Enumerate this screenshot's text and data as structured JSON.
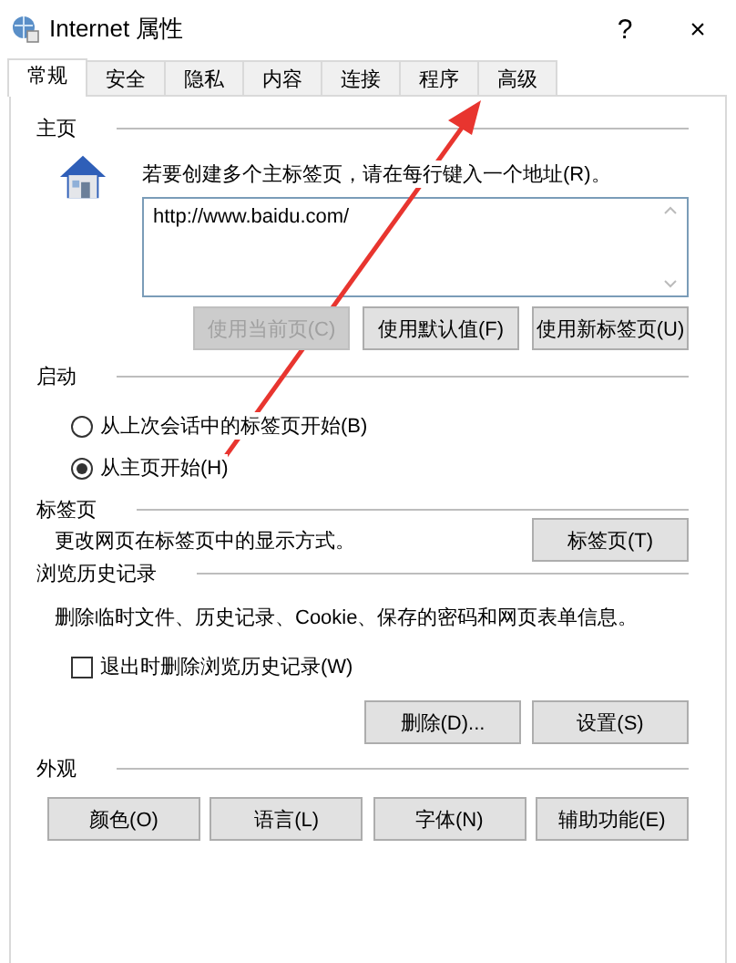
{
  "window": {
    "title": "Internet 属性",
    "help": "?",
    "close": "×"
  },
  "tabs": [
    {
      "label": "常规",
      "selected": true
    },
    {
      "label": "安全",
      "selected": false
    },
    {
      "label": "隐私",
      "selected": false
    },
    {
      "label": "内容",
      "selected": false
    },
    {
      "label": "连接",
      "selected": false
    },
    {
      "label": "程序",
      "selected": false
    },
    {
      "label": "高级",
      "selected": false
    }
  ],
  "home_page": {
    "heading": "主页",
    "instruction": "若要创建多个主标签页，请在每行键入一个地址(R)。",
    "addresses": "http://www.baidu.com/",
    "buttons": [
      {
        "label": "使用当前页(C)",
        "disabled": true
      },
      {
        "label": "使用默认值(F)",
        "disabled": false
      },
      {
        "label": "使用新标签页(U)",
        "disabled": false
      }
    ]
  },
  "startup": {
    "heading": "启动",
    "options": [
      {
        "label": "从上次会话中的标签页开始(B)",
        "selected": false
      },
      {
        "label": "从主页开始(H)",
        "selected": true
      }
    ]
  },
  "tabs_section": {
    "heading": "标签页",
    "description": "更改网页在标签页中的显示方式。",
    "button": "标签页(T)"
  },
  "browsing_history": {
    "heading": "浏览历史记录",
    "description": "删除临时文件、历史记录、Cookie、保存的密码和网页表单信息。",
    "delete_on_exit": {
      "label": "退出时删除浏览历史记录(W)",
      "checked": false
    },
    "buttons": [
      "删除(D)...",
      "设置(S)"
    ]
  },
  "appearance": {
    "heading": "外观",
    "buttons": [
      "颜色(O)",
      "语言(L)",
      "字体(N)",
      "辅助功能(E)"
    ]
  }
}
